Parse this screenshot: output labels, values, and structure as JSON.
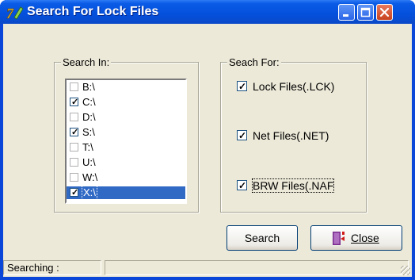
{
  "window": {
    "title": "Search For Lock Files",
    "title_color": "#0450dc"
  },
  "search_in": {
    "label": "Search In:",
    "drives": [
      {
        "label": "B:\\",
        "checked": false,
        "selected": false
      },
      {
        "label": "C:\\",
        "checked": true,
        "selected": false
      },
      {
        "label": "D:\\",
        "checked": false,
        "selected": false
      },
      {
        "label": "S:\\",
        "checked": true,
        "selected": false
      },
      {
        "label": "T:\\",
        "checked": false,
        "selected": false
      },
      {
        "label": "U:\\",
        "checked": false,
        "selected": false
      },
      {
        "label": "W:\\",
        "checked": false,
        "selected": false
      },
      {
        "label": "X:\\",
        "checked": true,
        "selected": true
      }
    ]
  },
  "search_for": {
    "label": "Seach For:",
    "options": [
      {
        "label": "Lock Files(.LCK)",
        "checked": true
      },
      {
        "label": "Net Files(.NET)",
        "checked": true
      },
      {
        "label": "BRW Files(.NAF",
        "checked": true
      }
    ]
  },
  "buttons": {
    "search": "Search",
    "close": "Close"
  },
  "status": {
    "text": "Searching :"
  }
}
